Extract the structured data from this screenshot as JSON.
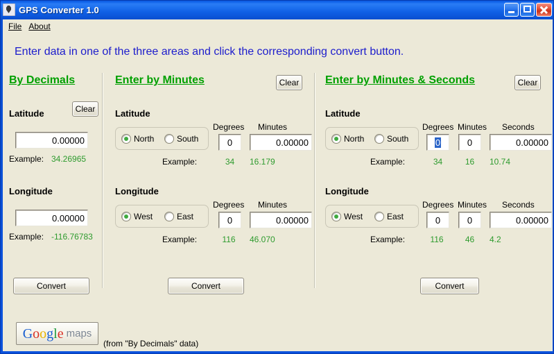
{
  "window": {
    "title": "GPS Converter 1.0",
    "icon": "gps-device-icon",
    "controls": {
      "minimize": "minimize-icon",
      "maximize": "maximize-icon",
      "close": "close-icon"
    },
    "frame_color": "#0a4ed1",
    "client_background": "#ece9d8"
  },
  "menu": {
    "items": [
      {
        "label": "File",
        "mnemonic": "F"
      },
      {
        "label": "About",
        "mnemonic": "A"
      }
    ]
  },
  "instruction": "Enter data in one of the three areas and click the corresponding convert button.",
  "colors": {
    "heading_green": "#00a000",
    "example_green": "#2e9b2e",
    "instruction_blue": "#1c1ccc",
    "selection_blue": "#2a64c8"
  },
  "panels": {
    "decimals": {
      "title": "By Decimals",
      "clear_label": "Clear",
      "convert_label": "Convert",
      "example_label": "Example:",
      "latitude": {
        "label": "Latitude",
        "value": "0.00000",
        "example": "34.26965"
      },
      "longitude": {
        "label": "Longitude",
        "value": "0.00000",
        "example": "-116.76783"
      }
    },
    "minutes": {
      "title": "Enter by Minutes",
      "clear_label": "Clear",
      "convert_label": "Convert",
      "example_label": "Example:",
      "columns": {
        "degrees": "Degrees",
        "minutes": "Minutes"
      },
      "latitude": {
        "label": "Latitude",
        "hemispheres": [
          {
            "label": "North",
            "selected": true
          },
          {
            "label": "South",
            "selected": false
          }
        ],
        "degrees_value": "0",
        "minutes_value": "0.00000",
        "degrees_example": "34",
        "minutes_example": "16.179"
      },
      "longitude": {
        "label": "Longitude",
        "hemispheres": [
          {
            "label": "West",
            "selected": true
          },
          {
            "label": "East",
            "selected": false
          }
        ],
        "degrees_value": "0",
        "minutes_value": "0.00000",
        "degrees_example": "116",
        "minutes_example": "46.070"
      }
    },
    "minutes_seconds": {
      "title": "Enter by Minutes & Seconds",
      "clear_label": "Clear",
      "convert_label": "Convert",
      "example_label": "Example:",
      "columns": {
        "degrees": "Degrees",
        "minutes": "Minutes",
        "seconds": "Seconds"
      },
      "latitude": {
        "label": "Latitude",
        "hemispheres": [
          {
            "label": "North",
            "selected": true
          },
          {
            "label": "South",
            "selected": false
          }
        ],
        "degrees_value": "0",
        "degrees_selected": true,
        "minutes_value": "0",
        "seconds_value": "0.00000",
        "degrees_example": "34",
        "minutes_example": "16",
        "seconds_example": "10.74"
      },
      "longitude": {
        "label": "Longitude",
        "hemispheres": [
          {
            "label": "West",
            "selected": true
          },
          {
            "label": "East",
            "selected": false
          }
        ],
        "degrees_value": "0",
        "minutes_value": "0",
        "seconds_value": "0.00000",
        "degrees_example": "116",
        "minutes_example": "46",
        "seconds_example": "4.2"
      }
    }
  },
  "footer": {
    "gmaps_logo": {
      "g1": "G",
      "o1": "o",
      "o2": "o",
      "g2": "g",
      "l1": "l",
      "e1": "e",
      "suffix": "maps"
    },
    "note": "(from \"By Decimals\" data)"
  }
}
